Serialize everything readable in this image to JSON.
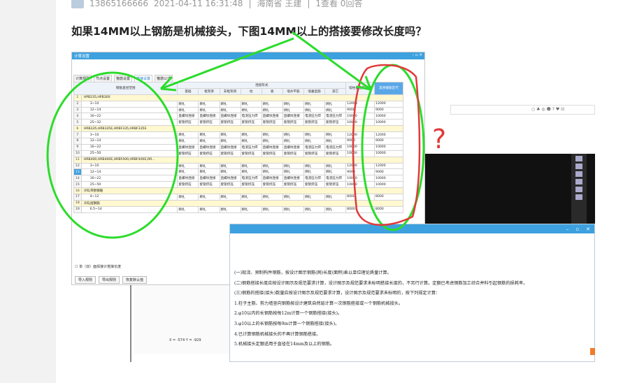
{
  "post_meta": {
    "user": "13865166666",
    "datetime": "2021-04-11 16:31:48",
    "location": "海南省 王建",
    "sep": "|",
    "stats": "1查看  0回答"
  },
  "question": {
    "title": "如果14MM以上钢筋是机械接头，下图14MM以上的搭接要修改长度吗？"
  },
  "settings_window": {
    "title": "计算设置",
    "tabs": [
      "计算规则",
      "节点设置",
      "箍筋设置",
      "搭接设置",
      "箍筋公式"
    ],
    "active_tab": "搭接设置",
    "header_group": "连接形式",
    "columns": [
      "",
      "钢筋直径范围",
      "基础",
      "框架梁",
      "非框架梁",
      "柱",
      "板",
      "墙水平筋",
      "墙垂直筋",
      "其它",
      "墙柱垂直筋定尺",
      "其余钢筋定尺"
    ],
    "rows": [
      {
        "n": "1",
        "g": true,
        "name": "HPB235,HPB300"
      },
      {
        "n": "2",
        "name": "3~10",
        "c": [
          "绑扎",
          "绑扎",
          "绑扎",
          "绑扎",
          "绑扎",
          "绑扎",
          "绑扎",
          "绑扎",
          "12000",
          "12000"
        ]
      },
      {
        "n": "3",
        "name": "12~14",
        "c": [
          "绑扎",
          "绑扎",
          "绑扎",
          "绑扎",
          "绑扎",
          "绑扎",
          "绑扎",
          "绑扎",
          "9000",
          "9000"
        ]
      },
      {
        "n": "4",
        "name": "16~22",
        "c": [
          "直螺纹连接",
          "直螺纹连接",
          "直螺纹连接",
          "电渣压力焊",
          "直螺纹连接",
          "直螺纹连接",
          "电渣压力焊",
          "电渣压力焊",
          "10000",
          "10000"
        ]
      },
      {
        "n": "5",
        "name": "25~32",
        "c": [
          "套管挤压",
          "套管挤压",
          "套管挤压",
          "套管挤压",
          "套管挤压",
          "套管挤压",
          "套管挤压",
          "套管挤压",
          "10000",
          "10000"
        ]
      },
      {
        "n": "6",
        "g": true,
        "name": "HRB335,HRB335E,HRBF335,HRBF335E"
      },
      {
        "n": "7",
        "name": "3~10",
        "c": [
          "绑扎",
          "绑扎",
          "绑扎",
          "绑扎",
          "绑扎",
          "绑扎",
          "绑扎",
          "绑扎",
          "12000",
          "12000"
        ]
      },
      {
        "n": "8",
        "name": "12~14",
        "c": [
          "绑扎",
          "绑扎",
          "绑扎",
          "绑扎",
          "绑扎",
          "绑扎",
          "绑扎",
          "绑扎",
          "9000",
          "9000"
        ]
      },
      {
        "n": "9",
        "name": "16~22",
        "c": [
          "直螺纹连接",
          "直螺纹连接",
          "直螺纹连接",
          "电渣压力焊",
          "直螺纹连接",
          "直螺纹连接",
          "电渣压力焊",
          "电渣压力焊",
          "10000",
          "10000"
        ]
      },
      {
        "n": "10",
        "name": "25~50",
        "c": [
          "套管挤压",
          "套管挤压",
          "套管挤压",
          "套管挤压",
          "套管挤压",
          "套管挤压",
          "套管挤压",
          "套管挤压",
          "10000",
          "10000"
        ]
      },
      {
        "n": "11",
        "g": true,
        "name": "HRB400,HRB400E,HRBF400,HRBF400E,RR..."
      },
      {
        "n": "12",
        "name": "3~10",
        "c": [
          "绑扎",
          "绑扎",
          "绑扎",
          "绑扎",
          "绑扎",
          "绑扎",
          "绑扎",
          "绑扎",
          "12000",
          "12000"
        ]
      },
      {
        "n": "13",
        "sel": true,
        "name": "12~14",
        "c": [
          "绑扎",
          "绑扎",
          "绑扎",
          "绑扎",
          "绑扎",
          "绑扎",
          "绑扎",
          "绑扎",
          "9000",
          "9000"
        ]
      },
      {
        "n": "14",
        "name": "16~22",
        "c": [
          "直螺纹连接",
          "直螺纹连接",
          "直螺纹连接",
          "电渣压力焊",
          "直螺纹连接",
          "直螺纹连接",
          "电渣压力焊",
          "电渣压力焊",
          "10000",
          "10000"
        ]
      },
      {
        "n": "15",
        "name": "25~50",
        "c": [
          "套管挤压",
          "套管挤压",
          "套管挤压",
          "套管挤压",
          "套管挤压",
          "套管挤压",
          "套管挤压",
          "套管挤压",
          "10000",
          "10000"
        ]
      },
      {
        "n": "16",
        "g": true,
        "name": "冷轧带肋钢筋"
      },
      {
        "n": "17",
        "name": "4~12",
        "c": [
          "绑扎",
          "绑扎",
          "绑扎",
          "绑扎",
          "绑扎",
          "绑扎",
          "绑扎",
          "绑扎",
          "8000",
          "8000"
        ]
      },
      {
        "n": "18",
        "g": true,
        "name": "冷轧扭钢筋"
      },
      {
        "n": "19",
        "name": "6.5~14",
        "c": [
          "绑扎",
          "绑扎",
          "绑扎",
          "绑扎",
          "绑扎",
          "绑扎",
          "绑扎",
          "绑扎",
          "8000",
          "8000"
        ]
      }
    ],
    "checkbox_label": "单（双）面焊接计搭接长度",
    "buttons": [
      "导入规则",
      "导出规则",
      "恢复默认值"
    ]
  },
  "rules_window": {
    "lines": [
      "(一)现浇、预制构件钢筋，按设计图示钢筋(网)长度(面积)乘以单位理论质量计算。",
      "(二)钢筋搭接长度应按设计图示及规范要求计算，设计图示及规范要求未标明搭接长度的，不另行计算。定额已考虑钢筋加工综合并料引起钢筋的损耗率。",
      "(三)钢筋的搭接(接头)数量应按设计图示及规范要求计算，设计图示及规范要求未标明的，按下列规定计算：",
      "1.柱子主筋、剪力墙竖向钢筋按设计建筑自然层计算一次钢筋搭接或一个钢筋机械接头。",
      "2.φ10以内的长钢筋按每12m计算一个钢筋搭接(接头)。",
      "3.φ10以上的长钢筋按每9m计算一个钢筋搭接(接头)。",
      "4.已计算钢筋机械接头的不再计算钢筋搭接。",
      "5.机械接头定额适用于直径在14mm及以上的钢筋。"
    ]
  },
  "coords_text": "X = -574  Y = -929",
  "annotation": {
    "question_mark": "?"
  },
  "colors": {
    "accent": "#3ea1df",
    "arrow": "#29e02b",
    "circle_red": "#e03a3a",
    "circle_green": "#2bdc2b"
  }
}
